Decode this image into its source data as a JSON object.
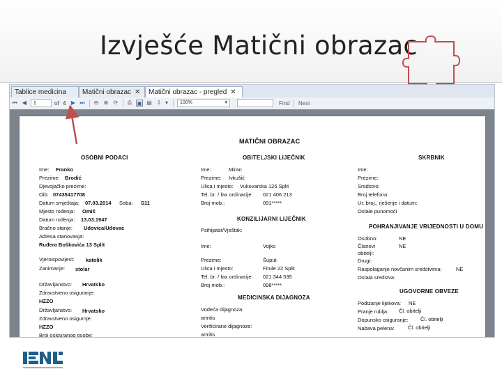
{
  "slide": {
    "title": "Izvješće Matični obrazac"
  },
  "tabs": [
    {
      "label": "Tablice medicina",
      "close": ""
    },
    {
      "label": "Matični obrazac",
      "close": "✕"
    },
    {
      "label": "Matični obrazac - pregled",
      "close": "✕"
    }
  ],
  "toolbar": {
    "page_current": "1",
    "page_of": "of",
    "page_total": "4",
    "zoom": "100%",
    "find_label": "Find",
    "next_label": "Next",
    "zoom_arrow": "▾",
    "first_icon": "⏮",
    "prev_icon": "◀",
    "next_icon": "▶",
    "last_icon": "⏭"
  },
  "report": {
    "title": "MATIČNI OBRAZAC",
    "osobni": {
      "heading": "OSOBNI PODACI",
      "rows": [
        {
          "label": "Ime:",
          "value": "Franko"
        },
        {
          "label": "Prezime:",
          "value": "Brodić"
        },
        {
          "label": "Djevojačko prezime:",
          "value": ""
        },
        {
          "label": "Oib:",
          "value": "07435417708"
        },
        {
          "label": "Datum smještaja:",
          "value": "07.03.2014"
        },
        {
          "label": "Mjesto rođenja:",
          "value": "Omiš"
        },
        {
          "label": "Datum rođenja:",
          "value": "13.03.1947"
        },
        {
          "label": "Bračno stanje:",
          "value": "Udovica/Udovac"
        },
        {
          "label": "Adresa stanovanja:",
          "value": ""
        },
        {
          "label": "",
          "value": "Ruđera Boškovića 13 Split"
        },
        {
          "label": "Vjeroispovijest:",
          "value": "katolik"
        },
        {
          "label": "Zanimanje:",
          "value": "stolar"
        },
        {
          "label": "Državljanstvo:",
          "value": "Hrvatsko"
        },
        {
          "label": "Zdravstveno osiguranje:",
          "value": ""
        },
        {
          "label": "",
          "value": "HZZO"
        },
        {
          "label": "Državljanstvo:",
          "value": "Hrvatsko"
        },
        {
          "label": "Zdravstveno osigurnje:",
          "value": ""
        },
        {
          "label": "",
          "value": "HZZO"
        },
        {
          "label": "Broj osiguranog osobe:",
          "value": ""
        }
      ],
      "soba_label": "Soba:",
      "soba_value": "S11"
    },
    "obiteljski": {
      "heading": "OBITELJSKI LIJEČNIK",
      "rows": [
        {
          "label": "Ime:",
          "value": "Miran"
        },
        {
          "label": "Prezime:",
          "value": "Ivkušić"
        },
        {
          "label": "Ulica i mjesto:",
          "value": "Vukovarska 126 Split"
        },
        {
          "label": "Tel. br. / fax ordinacije:",
          "value": "021 406 213"
        },
        {
          "label": "Broj mob.:",
          "value": "091*****"
        }
      ]
    },
    "konzilijarni": {
      "heading": "KONZILIJARNI LIJEČNIK",
      "rows": [
        {
          "label": "Psihijatar/Vještak:",
          "value": ""
        },
        {
          "label": "Ime:",
          "value": "Vojko"
        },
        {
          "label": "Prezime:",
          "value": "Šuput"
        },
        {
          "label": "Ulica i mjesto:",
          "value": "Firule 22 Split"
        },
        {
          "label": "Tel. br. / fax ordinacije:",
          "value": "021 344 535"
        },
        {
          "label": "Broj mob.:",
          "value": "098*****"
        }
      ]
    },
    "dijagnoza": {
      "heading": "MEDICINSKA DIJAGNOZA",
      "rows": [
        {
          "label": "Vodeća dijagnoza:",
          "value": ""
        },
        {
          "label": "artritis",
          "value": ""
        },
        {
          "label": "Verificirane dijagnoze:",
          "value": ""
        },
        {
          "label": "artritis",
          "value": ""
        }
      ]
    },
    "skrbnik": {
      "heading": "SKRBNIK",
      "rows": [
        {
          "label": "Ime:",
          "value": ""
        },
        {
          "label": "Prezime:",
          "value": ""
        },
        {
          "label": "Srodstvo:",
          "value": ""
        },
        {
          "label": "Broj telefona:",
          "value": ""
        },
        {
          "label": "Ur. broj., rješenje i datum:",
          "value": ""
        },
        {
          "label": "Ostale punomoći",
          "value": ""
        }
      ]
    },
    "pohranjivanje": {
      "heading": "POHRANJIVANJE VRIJEDNOSTI U DOMU",
      "rows": [
        {
          "label": "Osobno:",
          "value": "NE"
        },
        {
          "label": "Članovi",
          "value": "NE"
        },
        {
          "label": "obitelji:",
          "value": ""
        },
        {
          "label": "Drugi:",
          "value": ""
        },
        {
          "label": "Raspolaganje novčanim sredstvima:",
          "value": "NE"
        },
        {
          "label": "Ostala sredstva:",
          "value": ""
        }
      ]
    },
    "ugovorne": {
      "heading": "UGOVORNE OBVEZE",
      "rows": [
        {
          "label": "Podizanje lijekova:",
          "value": "NE"
        },
        {
          "label": "Pranje rublja:",
          "value": "Čl. obitelji"
        },
        {
          "label": "Dopunsko osiguranje:",
          "value": "Čl. obitelji"
        },
        {
          "label": "Nabava pelena:",
          "value": "Čl. obitelji"
        }
      ]
    }
  },
  "colors": {
    "arrow": "#c0504d",
    "puzzle": "#c0504d",
    "logo": "#1f5e8c"
  }
}
